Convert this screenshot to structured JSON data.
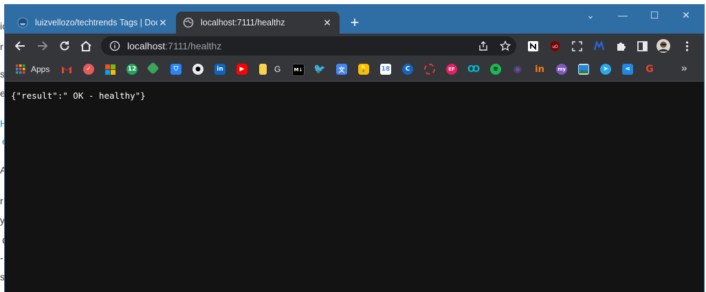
{
  "background": {
    "fragments": [
      "ic",
      "r",
      "s",
      "e",
      "H",
      "e",
      "A",
      "r",
      "y",
      "C",
      "-",
      "sh"
    ]
  },
  "tabs": [
    {
      "title": "luizvellozo/techtrends Tags | Doc",
      "close": "✕",
      "active": false
    },
    {
      "title": "localhost:7111/healthz",
      "close": "✕",
      "active": true
    }
  ],
  "new_tab": "+",
  "window_controls": {
    "dropdown": "⌄",
    "minimize": "—",
    "maximize": "☐",
    "close": "✕"
  },
  "omnibox": {
    "host": "localhost",
    "path": ":7111/healthz"
  },
  "bookmarks": {
    "apps_label": "Apps",
    "g_label": "G",
    "more": "»"
  },
  "page": {
    "body_text": "{\"result\":\" OK - healthy\"}"
  },
  "colors": {
    "tab_strip": "#2f6ea5",
    "toolbar": "#35363a",
    "content_bg": "#131313"
  }
}
